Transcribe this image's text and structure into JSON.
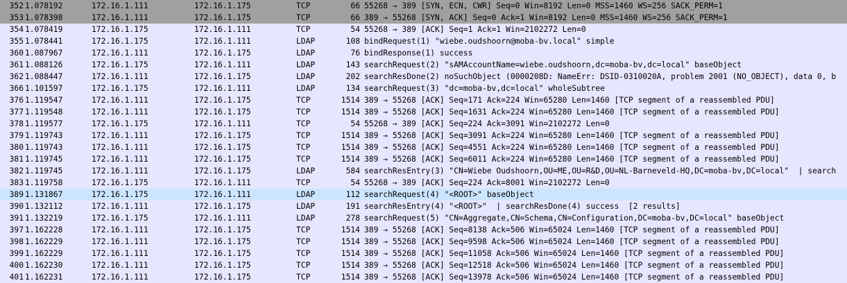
{
  "colors": {
    "tcp_handshake": "#a0a0a0",
    "tcp": "#e7e6ff",
    "ldap": "#e7e6ff",
    "selected": "#cce5ff",
    "text": "#000000"
  },
  "packets": [
    {
      "no": "352",
      "time": "1.078192",
      "src": "172.16.1.111",
      "dst": "172.16.1.175",
      "proto": "TCP",
      "len": "66",
      "info": "55268 → 389 [SYN, ECN, CWR] Seq=0 Win=8192 Len=0 MSS=1460 WS=256 SACK_PERM=1",
      "style": "tcp_handshake"
    },
    {
      "no": "353",
      "time": "1.078398",
      "src": "172.16.1.111",
      "dst": "172.16.1.175",
      "proto": "TCP",
      "len": "66",
      "info": "389 → 55268 [SYN, ACK] Seq=0 Ack=1 Win=8192 Len=0 MSS=1460 WS=256 SACK_PERM=1",
      "style": "tcp_handshake"
    },
    {
      "no": "354",
      "time": "1.078419",
      "src": "172.16.1.175",
      "dst": "172.16.1.111",
      "proto": "TCP",
      "len": "54",
      "info": "55268 → 389 [ACK] Seq=1 Ack=1 Win=2102272 Len=0",
      "style": "tcp"
    },
    {
      "no": "355",
      "time": "1.078441",
      "src": "172.16.1.175",
      "dst": "172.16.1.111",
      "proto": "LDAP",
      "len": "108",
      "info": "bindRequest(1) \"wiebe.oudshoorn@moba-bv.local\" simple",
      "style": "ldap"
    },
    {
      "no": "360",
      "time": "1.087967",
      "src": "172.16.1.111",
      "dst": "172.16.1.175",
      "proto": "LDAP",
      "len": "76",
      "info": "bindResponse(1) success",
      "style": "ldap"
    },
    {
      "no": "361",
      "time": "1.088126",
      "src": "172.16.1.175",
      "dst": "172.16.1.111",
      "proto": "LDAP",
      "len": "143",
      "info": "searchRequest(2) \"sAMAccountName=wiebe.oudshoorn,dc=moba-bv,dc=local\" baseObject",
      "style": "ldap"
    },
    {
      "no": "362",
      "time": "1.088447",
      "src": "172.16.1.111",
      "dst": "172.16.1.175",
      "proto": "LDAP",
      "len": "202",
      "info": "searchResDone(2) noSuchObject (0000208D: NameErr: DSID-0310020A, problem 2001 (NO_OBJECT), data 0, b",
      "style": "ldap"
    },
    {
      "no": "366",
      "time": "1.101597",
      "src": "172.16.1.175",
      "dst": "172.16.1.111",
      "proto": "LDAP",
      "len": "134",
      "info": "searchRequest(3) \"dc=moba-bv,dc=local\" wholeSubtree",
      "style": "ldap"
    },
    {
      "no": "376",
      "time": "1.119547",
      "src": "172.16.1.111",
      "dst": "172.16.1.175",
      "proto": "TCP",
      "len": "1514",
      "info": "389 → 55268 [ACK] Seq=171 Ack=224 Win=65280 Len=1460 [TCP segment of a reassembled PDU]",
      "style": "tcp"
    },
    {
      "no": "377",
      "time": "1.119548",
      "src": "172.16.1.111",
      "dst": "172.16.1.175",
      "proto": "TCP",
      "len": "1514",
      "info": "389 → 55268 [ACK] Seq=1631 Ack=224 Win=65280 Len=1460 [TCP segment of a reassembled PDU]",
      "style": "tcp"
    },
    {
      "no": "378",
      "time": "1.119577",
      "src": "172.16.1.175",
      "dst": "172.16.1.111",
      "proto": "TCP",
      "len": "54",
      "info": "55268 → 389 [ACK] Seq=224 Ack=3091 Win=2102272 Len=0",
      "style": "tcp"
    },
    {
      "no": "379",
      "time": "1.119743",
      "src": "172.16.1.111",
      "dst": "172.16.1.175",
      "proto": "TCP",
      "len": "1514",
      "info": "389 → 55268 [ACK] Seq=3091 Ack=224 Win=65280 Len=1460 [TCP segment of a reassembled PDU]",
      "style": "tcp"
    },
    {
      "no": "380",
      "time": "1.119743",
      "src": "172.16.1.111",
      "dst": "172.16.1.175",
      "proto": "TCP",
      "len": "1514",
      "info": "389 → 55268 [ACK] Seq=4551 Ack=224 Win=65280 Len=1460 [TCP segment of a reassembled PDU]",
      "style": "tcp"
    },
    {
      "no": "381",
      "time": "1.119745",
      "src": "172.16.1.111",
      "dst": "172.16.1.175",
      "proto": "TCP",
      "len": "1514",
      "info": "389 → 55268 [ACK] Seq=6011 Ack=224 Win=65280 Len=1460 [TCP segment of a reassembled PDU]",
      "style": "tcp"
    },
    {
      "no": "382",
      "time": "1.119745",
      "src": "172.16.1.111",
      "dst": "172.16.1.175",
      "proto": "LDAP",
      "len": "584",
      "info": "searchResEntry(3) \"CN=Wiebe Oudshoorn,OU=ME,OU=R&D,OU=NL-Barneveld-HQ,DC=moba-bv,DC=local\"  | search",
      "style": "ldap"
    },
    {
      "no": "383",
      "time": "1.119758",
      "src": "172.16.1.175",
      "dst": "172.16.1.111",
      "proto": "TCP",
      "len": "54",
      "info": "55268 → 389 [ACK] Seq=224 Ack=8001 Win=2102272 Len=0",
      "style": "tcp"
    },
    {
      "no": "389",
      "time": "1.131867",
      "src": "172.16.1.175",
      "dst": "172.16.1.111",
      "proto": "LDAP",
      "len": "112",
      "info": "searchRequest(4) \"<ROOT>\" baseObject",
      "style": "selected"
    },
    {
      "no": "390",
      "time": "1.132112",
      "src": "172.16.1.111",
      "dst": "172.16.1.175",
      "proto": "LDAP",
      "len": "191",
      "info": "searchResEntry(4) \"<ROOT>\"  | searchResDone(4) success  [2 results]",
      "style": "ldap"
    },
    {
      "no": "391",
      "time": "1.132219",
      "src": "172.16.1.175",
      "dst": "172.16.1.111",
      "proto": "LDAP",
      "len": "278",
      "info": "searchRequest(5) \"CN=Aggregate,CN=Schema,CN=Configuration,DC=moba-bv,DC=local\" baseObject",
      "style": "ldap"
    },
    {
      "no": "397",
      "time": "1.162228",
      "src": "172.16.1.111",
      "dst": "172.16.1.175",
      "proto": "TCP",
      "len": "1514",
      "info": "389 → 55268 [ACK] Seq=8138 Ack=506 Win=65024 Len=1460 [TCP segment of a reassembled PDU]",
      "style": "tcp"
    },
    {
      "no": "398",
      "time": "1.162229",
      "src": "172.16.1.111",
      "dst": "172.16.1.175",
      "proto": "TCP",
      "len": "1514",
      "info": "389 → 55268 [ACK] Seq=9598 Ack=506 Win=65024 Len=1460 [TCP segment of a reassembled PDU]",
      "style": "tcp"
    },
    {
      "no": "399",
      "time": "1.162229",
      "src": "172.16.1.111",
      "dst": "172.16.1.175",
      "proto": "TCP",
      "len": "1514",
      "info": "389 → 55268 [ACK] Seq=11058 Ack=506 Win=65024 Len=1460 [TCP segment of a reassembled PDU]",
      "style": "tcp"
    },
    {
      "no": "400",
      "time": "1.162230",
      "src": "172.16.1.111",
      "dst": "172.16.1.175",
      "proto": "TCP",
      "len": "1514",
      "info": "389 → 55268 [ACK] Seq=12518 Ack=506 Win=65024 Len=1460 [TCP segment of a reassembled PDU]",
      "style": "tcp"
    },
    {
      "no": "401",
      "time": "1.162231",
      "src": "172.16.1.111",
      "dst": "172.16.1.175",
      "proto": "TCP",
      "len": "1514",
      "info": "389 → 55268 [ACK] Seq=13978 Ack=506 Win=65024 Len=1460 [TCP segment of a reassembled PDU]",
      "style": "tcp"
    }
  ]
}
